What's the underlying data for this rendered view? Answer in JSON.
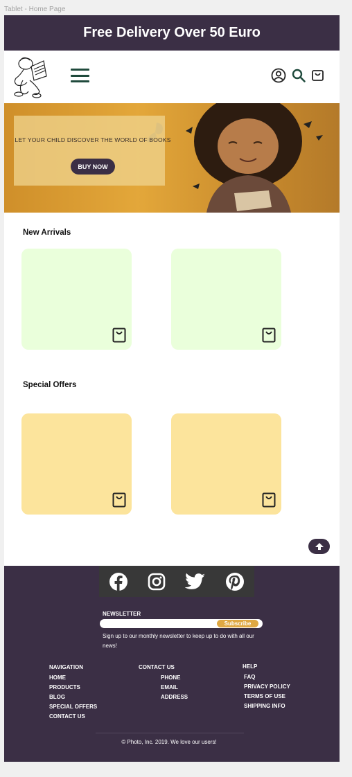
{
  "frame_label": "Tablet - Home Page",
  "promo_bar": {
    "text": "Free Delivery Over 50 Euro"
  },
  "hero": {
    "tagline": "LET YOUR CHILD DISCOVER THE WORLD OF BOOKS",
    "button_label": "BUY NOW"
  },
  "sections": {
    "new_arrivals": {
      "title": "New Arrivals"
    },
    "special_offers": {
      "title": "Special Offers"
    }
  },
  "footer": {
    "social_icons": [
      "facebook-icon",
      "instagram-icon",
      "twitter-icon",
      "pinterest-icon"
    ],
    "newsletter": {
      "title": "NEWSLETTER",
      "placeholder": "",
      "button_label": "Subscribe",
      "description": "Sign up to our monthly newsletter to keep up to do with all our news!"
    },
    "navigation": {
      "heading": "NAVIGATION",
      "links": [
        "HOME",
        "PRODUCTS",
        "BLOG",
        "SPECIAL OFFERS",
        "CONTACT US"
      ]
    },
    "contact": {
      "heading": "CONTACT US",
      "links": [
        "PHONE",
        "EMAIL",
        "ADDRESS"
      ]
    },
    "help": {
      "heading": "HELP",
      "links": [
        "FAQ",
        "PRIVACY POLICY",
        "TERMS OF USE",
        "SHIPPING INFO"
      ]
    },
    "copyright": "© Photo, Inc. 2019. We love our users!"
  },
  "colors": {
    "brand_dark": "#3b2f45",
    "card_green": "#eaffdb",
    "card_yellow": "#fce49c",
    "accent": "#dfa843",
    "icon_green": "#1f4a3c"
  }
}
